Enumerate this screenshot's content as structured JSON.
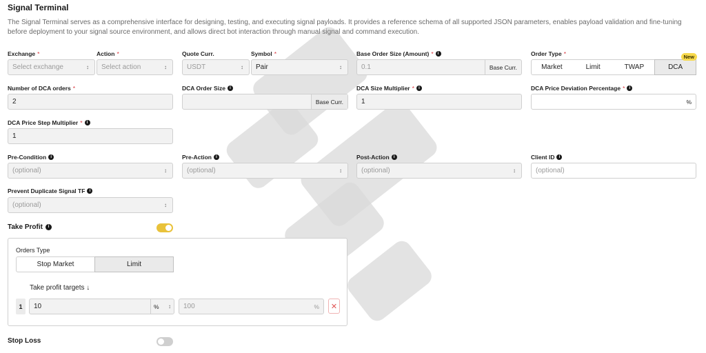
{
  "page": {
    "title": "Signal Terminal",
    "description": "The Signal Terminal serves as a comprehensive interface for designing, testing, and executing signal payloads. It provides a reference schema of all supported JSON parameters, enables payload validation and fine-tuning before deployment to your signal source environment, and allows direct bot interaction through manual signal and command execution."
  },
  "fields": {
    "exchange": {
      "label": "Exchange",
      "placeholder": "Select exchange"
    },
    "action": {
      "label": "Action",
      "placeholder": "Select action"
    },
    "quote_curr": {
      "label": "Quote Curr.",
      "value": "USDT"
    },
    "symbol": {
      "label": "Symbol",
      "value": "Pair"
    },
    "base_order_size": {
      "label": "Base Order Size (Amount)",
      "placeholder": "0.1",
      "suffix": "Base Curr."
    },
    "order_type": {
      "label": "Order Type",
      "options": [
        "Market",
        "Limit",
        "TWAP",
        "DCA"
      ],
      "selected": "DCA",
      "badge": "New"
    },
    "num_dca_orders": {
      "label": "Number of DCA orders",
      "value": "2"
    },
    "dca_order_size": {
      "label": "DCA Order Size",
      "value": "",
      "suffix": "Base Curr."
    },
    "dca_size_multiplier": {
      "label": "DCA Size Multiplier",
      "value": "1"
    },
    "dca_price_deviation": {
      "label": "DCA Price Deviation Percentage",
      "value": "",
      "suffix": "%"
    },
    "dca_price_step_multiplier": {
      "label": "DCA Price Step Multiplier",
      "value": "1"
    },
    "pre_condition": {
      "label": "Pre-Condition",
      "placeholder": "(optional)"
    },
    "pre_action": {
      "label": "Pre-Action",
      "placeholder": "(optional)"
    },
    "post_action": {
      "label": "Post-Action",
      "placeholder": "(optional)"
    },
    "client_id": {
      "label": "Client ID",
      "placeholder": "(optional)"
    },
    "prevent_duplicate": {
      "label": "Prevent Duplicate Signal TF",
      "placeholder": "(optional)"
    }
  },
  "take_profit": {
    "label": "Take Profit",
    "enabled": true,
    "orders_type_label": "Orders Type",
    "orders_type_options": [
      "Stop Market",
      "Limit"
    ],
    "orders_type_selected": "Limit",
    "targets_label": "Take profit targets ↓",
    "targets": [
      {
        "index": "1",
        "price": "10",
        "unit": "%",
        "amount_placeholder": "100",
        "amount_unit": "%"
      }
    ],
    "remove_symbol": "✕"
  },
  "stop_loss": {
    "label": "Stop Loss",
    "enabled": false
  },
  "symbols": {
    "chevron": "⌃⌄",
    "required": "*",
    "info": "i"
  },
  "colors": {
    "toggle_on": "#e9c23a",
    "badge": "#f7d94c",
    "required": "#d9363e",
    "remove": "#e05252"
  }
}
